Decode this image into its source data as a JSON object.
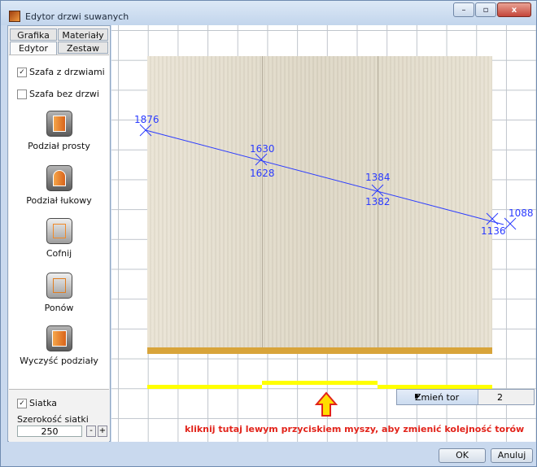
{
  "window": {
    "title": "Edytor drzwi suwanych",
    "controls": {
      "minimize": "–",
      "maximize": "▫",
      "close": "x"
    }
  },
  "tabs": [
    {
      "label": "Grafika"
    },
    {
      "label": "Materiały"
    },
    {
      "label": "Edytor"
    },
    {
      "label": "Zestaw"
    }
  ],
  "panel": {
    "checkbox_with_doors": {
      "label": "Szafa z drzwiami",
      "checked": true
    },
    "checkbox_without_doors": {
      "label": "Szafa bez drzwi",
      "checked": false
    },
    "tools": [
      {
        "label": "Podział prosty",
        "icon": "straight-split-icon"
      },
      {
        "label": "Podział łukowy",
        "icon": "arc-split-icon"
      },
      {
        "label": "Cofnij",
        "icon": "undo-icon"
      },
      {
        "label": "Ponów",
        "icon": "redo-icon"
      },
      {
        "label": "Wyczyść podziały",
        "icon": "clear-splits-icon"
      }
    ],
    "grid_checkbox": {
      "label": "Siatka",
      "checked": true
    },
    "grid_size_label": "Szerokość siatki",
    "grid_size_value": "250",
    "minus": "-",
    "plus": "+"
  },
  "canvas": {
    "measure_labels": [
      "1876",
      "1630",
      "1628",
      "1384",
      "1382",
      "1136",
      "1088"
    ],
    "hint_text": "kliknij tutaj lewym przyciskiem myszy, aby zmienić kolejność torów",
    "context_menu": {
      "item": "Zmień tor",
      "value": "2"
    }
  },
  "footer": {
    "ok": "OK",
    "cancel": "Anuluj"
  },
  "colors": {
    "track": "#ffff00",
    "rail": "#d8a43a",
    "measure_line": "#2b3bff",
    "hint": "#e2231a"
  }
}
